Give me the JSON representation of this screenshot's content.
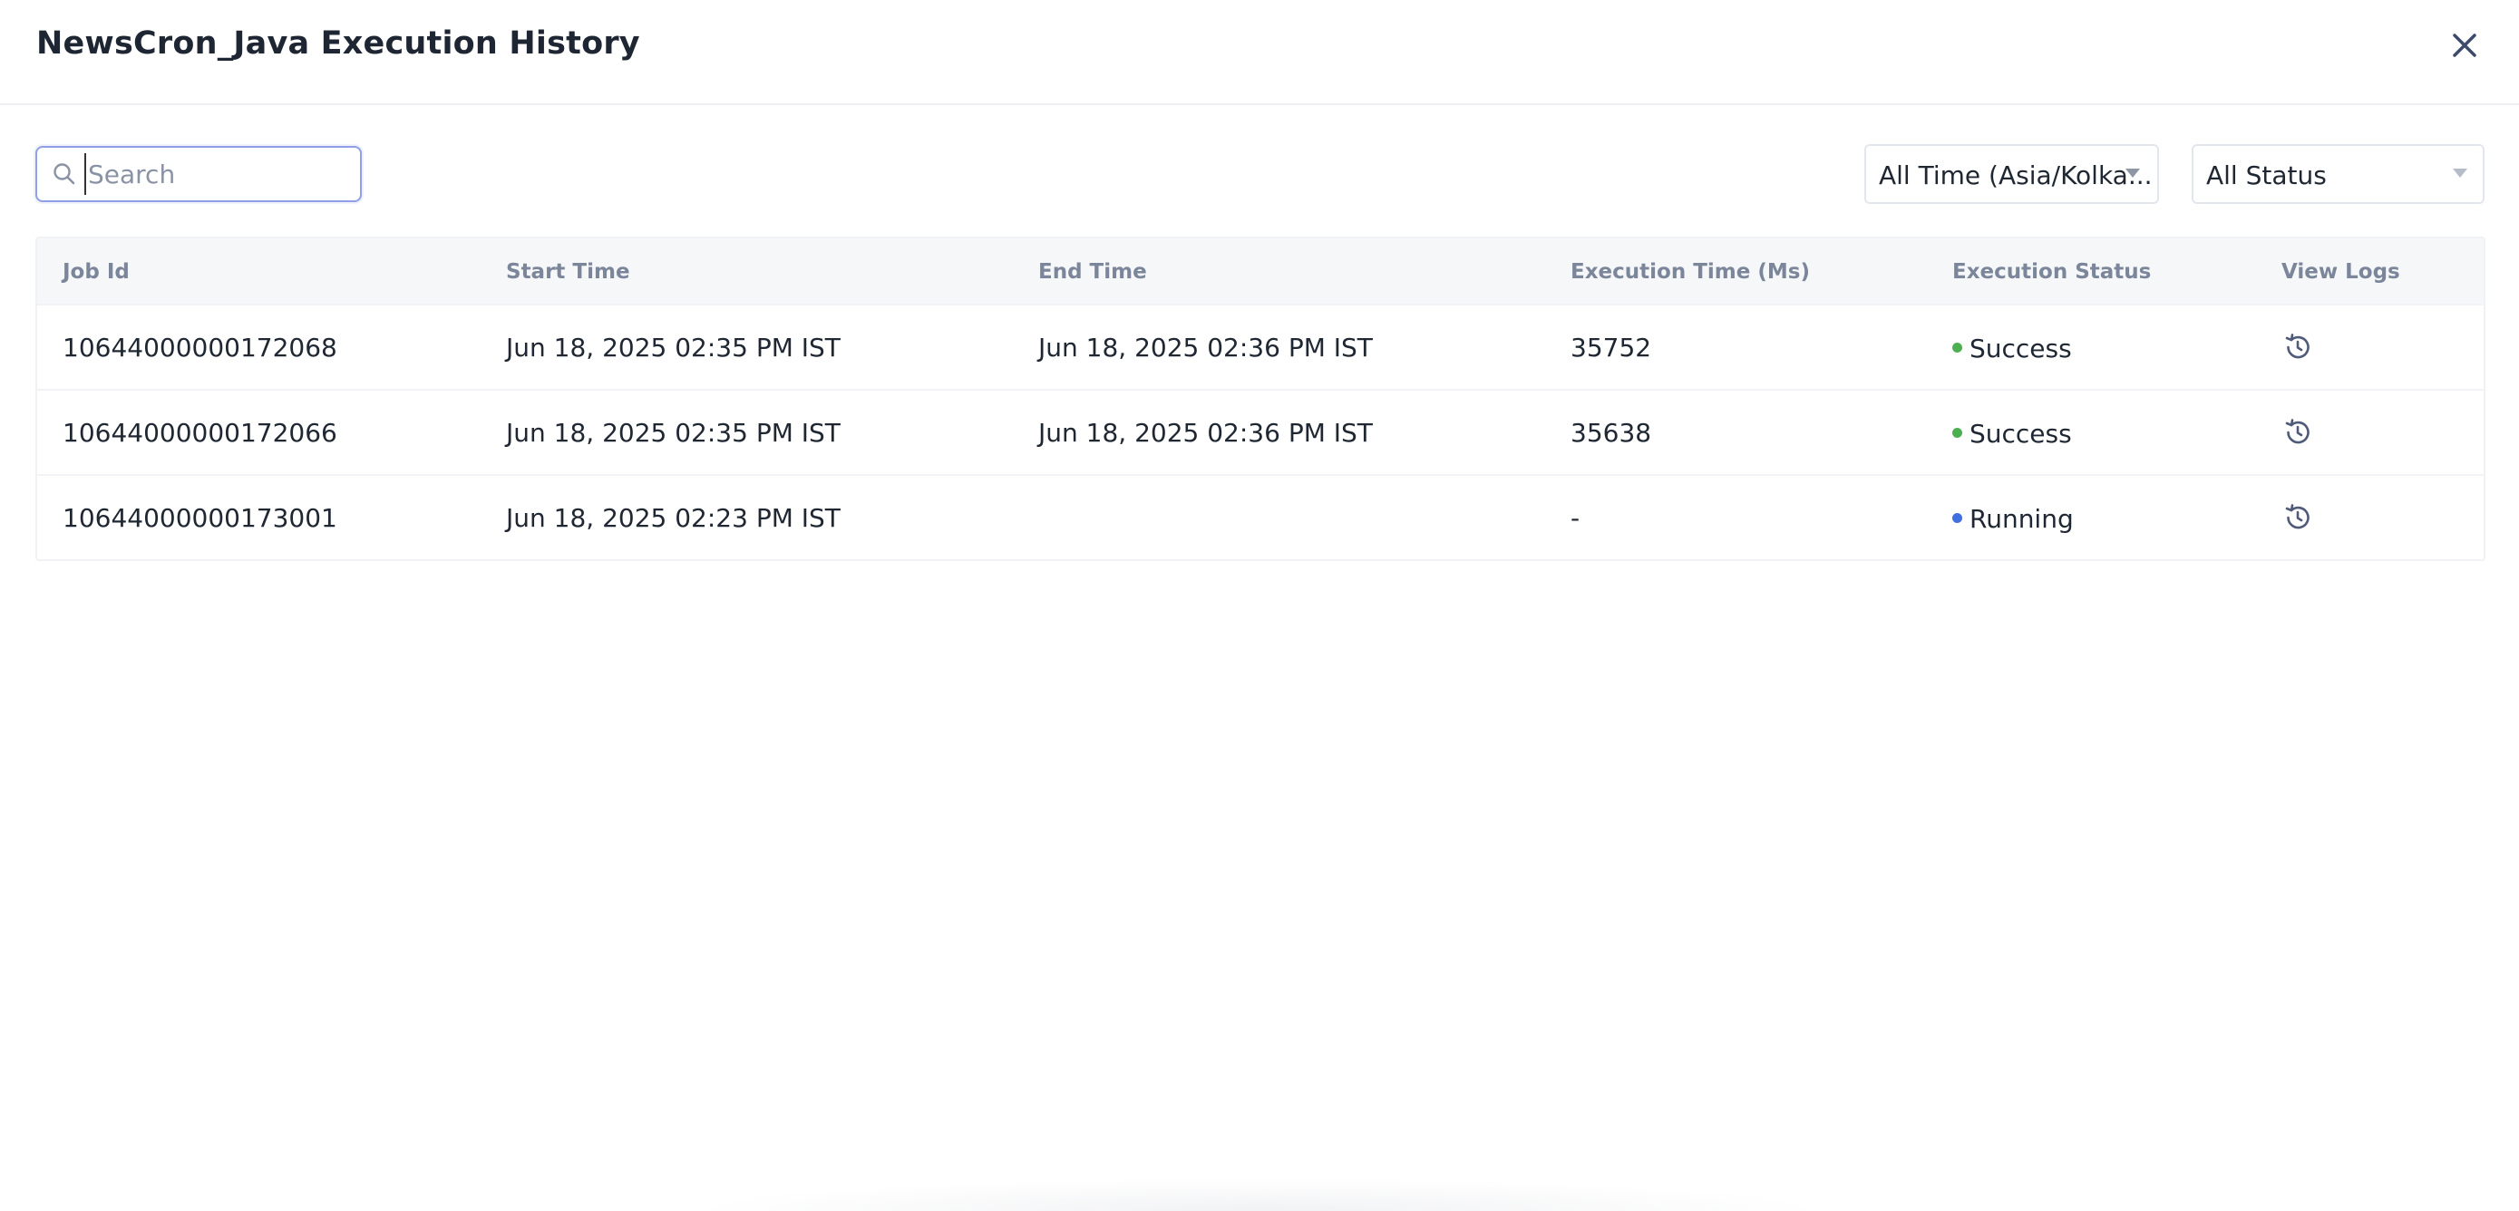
{
  "modal": {
    "title": "NewsCron_Java Execution History"
  },
  "toolbar": {
    "search_placeholder": "Search",
    "search_value": "",
    "time_filter": "All Time (Asia/Kolka...",
    "status_filter": "All Status"
  },
  "table": {
    "columns": [
      "Job Id",
      "Start Time",
      "End Time",
      "Execution Time (Ms)",
      "Execution Status",
      "View Logs"
    ],
    "rows": [
      {
        "job_id": "10644000000172068",
        "start_time": "Jun 18, 2025 02:35 PM IST",
        "end_time": "Jun 18, 2025 02:36 PM IST",
        "execution_time": "35752",
        "status": "Success",
        "status_color": "#4caf50",
        "logs_icon": "history-icon"
      },
      {
        "job_id": "10644000000172066",
        "start_time": "Jun 18, 2025 02:35 PM IST",
        "end_time": "Jun 18, 2025 02:36 PM IST",
        "execution_time": "35638",
        "status": "Success",
        "status_color": "#4caf50",
        "logs_icon": "history-icon"
      },
      {
        "job_id": "10644000000173001",
        "start_time": "Jun 18, 2025 02:23 PM IST",
        "end_time": "",
        "execution_time": "-",
        "status": "Running",
        "status_color": "#3f6fe0",
        "logs_icon": "history-icon"
      }
    ]
  },
  "colors": {
    "accent": "#8fa0e6",
    "header_text": "#7c869a",
    "success": "#4caf50",
    "running": "#3f6fe0"
  }
}
